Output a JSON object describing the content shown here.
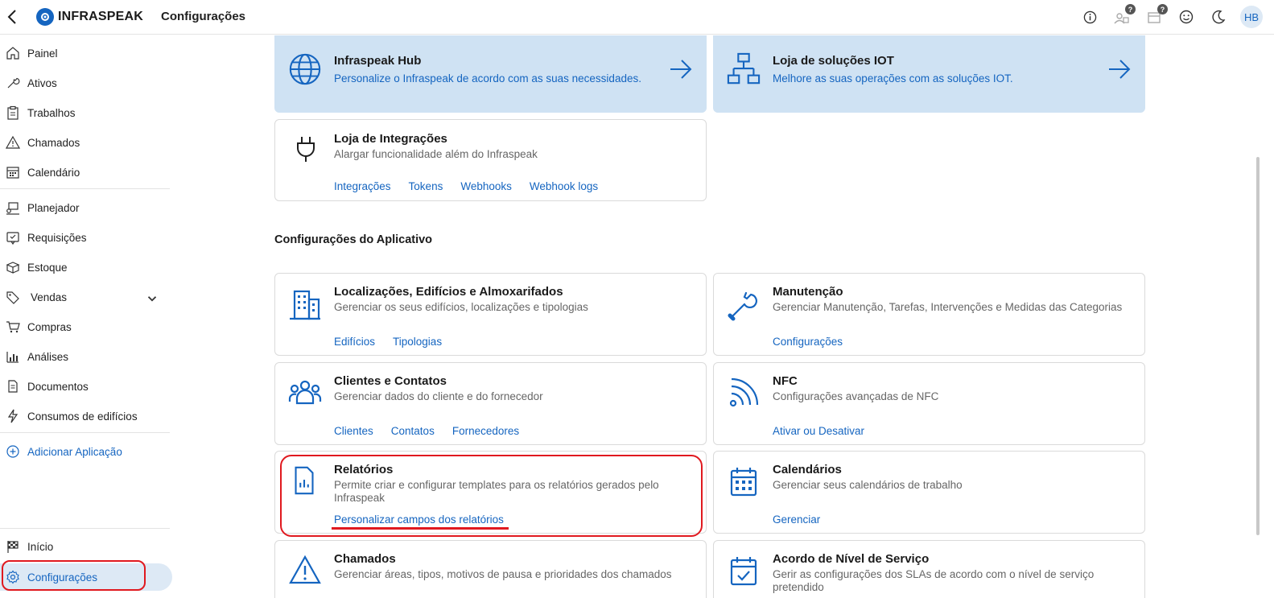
{
  "header": {
    "brand": "INFRASPEAK",
    "title": "Configurações",
    "avatar_initials": "HB",
    "badge_q1": "?",
    "badge_q2": "?"
  },
  "sidebar": {
    "items": [
      {
        "label": "Painel",
        "icon": "home-icon"
      },
      {
        "label": "Ativos",
        "icon": "wrench-icon"
      },
      {
        "label": "Trabalhos",
        "icon": "clipboard-icon"
      },
      {
        "label": "Chamados",
        "icon": "warning-icon"
      },
      {
        "label": "Calendário",
        "icon": "calendar-icon"
      },
      {
        "label": "Planejador",
        "icon": "planner-icon"
      },
      {
        "label": "Requisições",
        "icon": "request-icon"
      },
      {
        "label": "Estoque",
        "icon": "box-icon"
      },
      {
        "label": "Vendas",
        "icon": "tag-icon"
      },
      {
        "label": "Compras",
        "icon": "cart-icon"
      },
      {
        "label": "Análises",
        "icon": "chart-icon"
      },
      {
        "label": "Documentos",
        "icon": "document-icon"
      },
      {
        "label": "Consumos de edifícios",
        "icon": "bolt-icon"
      }
    ],
    "add_app": "Adicionar Aplicação",
    "inicio": "Início",
    "config": "Configurações"
  },
  "main": {
    "hub": {
      "title": "Infraspeak Hub",
      "desc": "Personalize o Infraspeak de acordo com as suas necessidades."
    },
    "iot": {
      "title": "Loja de soluções IOT",
      "desc": "Melhore as suas operações com as soluções IOT."
    },
    "integrations": {
      "title": "Loja de Integrações",
      "desc": "Alargar funcionalidade além do Infraspeak",
      "links": [
        "Integrações",
        "Tokens",
        "Webhooks",
        "Webhook logs"
      ]
    },
    "section_title": "Configurações do Aplicativo",
    "cards": [
      {
        "title": "Localizações, Edifícios e Almoxarifados",
        "desc": "Gerenciar os seus edifícios, localizações e tipologias",
        "links": [
          "Edifícios",
          "Tipologias"
        ]
      },
      {
        "title": "Manutenção",
        "desc": "Gerenciar Manutenção, Tarefas, Intervenções e Medidas das Categorias",
        "links": [
          "Configurações"
        ]
      },
      {
        "title": "Clientes e Contatos",
        "desc": "Gerenciar dados do cliente e do fornecedor",
        "links": [
          "Clientes",
          "Contatos",
          "Fornecedores"
        ]
      },
      {
        "title": "NFC",
        "desc": "Configurações avançadas de NFC",
        "links": [
          "Ativar ou Desativar"
        ]
      },
      {
        "title": "Relatórios",
        "desc": "Permite criar e configurar templates para os relatórios gerados pelo Infraspeak",
        "links": [
          "Personalizar campos dos relatórios"
        ]
      },
      {
        "title": "Calendários",
        "desc": "Gerenciar seus calendários de trabalho",
        "links": [
          "Gerenciar"
        ]
      },
      {
        "title": "Chamados",
        "desc": "Gerenciar áreas, tipos, motivos de pausa e prioridades dos chamados",
        "links": []
      },
      {
        "title": "Acordo de Nível de Serviço",
        "desc": "Gerir as configurações dos SLAs de acordo com o nível de serviço pretendido",
        "links": []
      }
    ]
  },
  "colors": {
    "accent": "#1565c0",
    "hub_bg": "#cfe2f3",
    "highlight": "#e0191f"
  }
}
